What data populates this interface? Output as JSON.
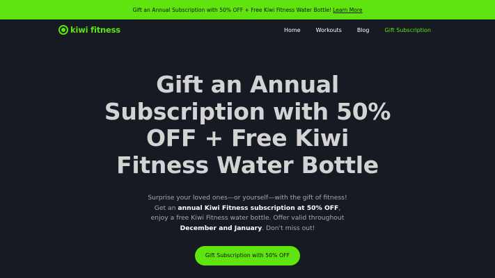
{
  "promo": {
    "text": "Gift an Annual Subscription with 50% OFF + Free Kiwi Fitness Water Bottle!",
    "link": "Learn More"
  },
  "nav": {
    "brand": "kiwi fitness",
    "links": [
      "Home",
      "Workouts",
      "Blog",
      "Gift Subscription"
    ]
  },
  "hero": {
    "title": "Gift an Annual Subscription with 50% OFF + Free Kiwi Fitness Water Bottle",
    "desc_1": "Surprise your loved ones—or yourself—with the gift of fitness! Get an ",
    "desc_bold_1": "annual Kiwi Fitness subscription at 50% OFF",
    "desc_2": ", enjoy a free Kiwi Fitness water bottle. Offer valid throughout ",
    "desc_bold_2": "December and January",
    "desc_3": ". Don't miss out!",
    "cta": "Gift Subscription with 50% OFF"
  },
  "colors": {
    "accent": "#5fe40f",
    "background": "#161a23"
  }
}
